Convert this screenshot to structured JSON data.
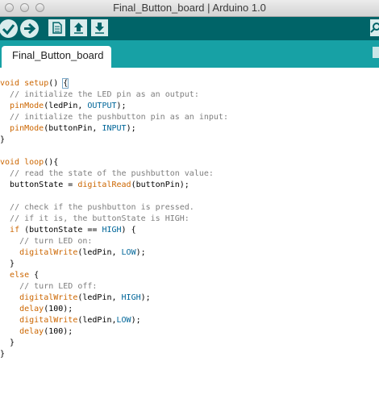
{
  "window": {
    "title": "Final_Button_board | Arduino 1.0"
  },
  "toolbar": {
    "buttons": [
      "checkmark-icon",
      "arrow-right-icon",
      "new-file-icon",
      "upload-arrow-icon",
      "download-arrow-icon",
      "search-icon"
    ]
  },
  "tabs": {
    "active_label": "Final_Button_board"
  },
  "code": {
    "lines": [
      "void setup() {",
      "  // initialize the LED pin as an output:",
      "  pinMode(ledPin, OUTPUT);",
      "  // initialize the pushbutton pin as an input:",
      "  pinMode(buttonPin, INPUT);",
      "}",
      "",
      "void loop(){",
      "  // read the state of the pushbutton value:",
      "  buttonState = digitalRead(buttonPin);",
      "",
      "  // check if the pushbutton is pressed.",
      "  // if it is, the buttonState is HIGH:",
      "  if (buttonState == HIGH) {",
      "    // turn LED on:",
      "    digitalWrite(ledPin, LOW);",
      "  }",
      "  else {",
      "    // turn LED off:",
      "    digitalWrite(ledPin, HIGH);",
      "    delay(100);",
      "    digitalWrite(ledPin,LOW);",
      "    delay(100);",
      "  }",
      "}"
    ]
  },
  "colors": {
    "toolbar_bg": "#006468",
    "tabbar_bg": "#17a1a5",
    "keyword": "#cc6600",
    "constant": "#006699",
    "comment": "#7e7e7e"
  }
}
